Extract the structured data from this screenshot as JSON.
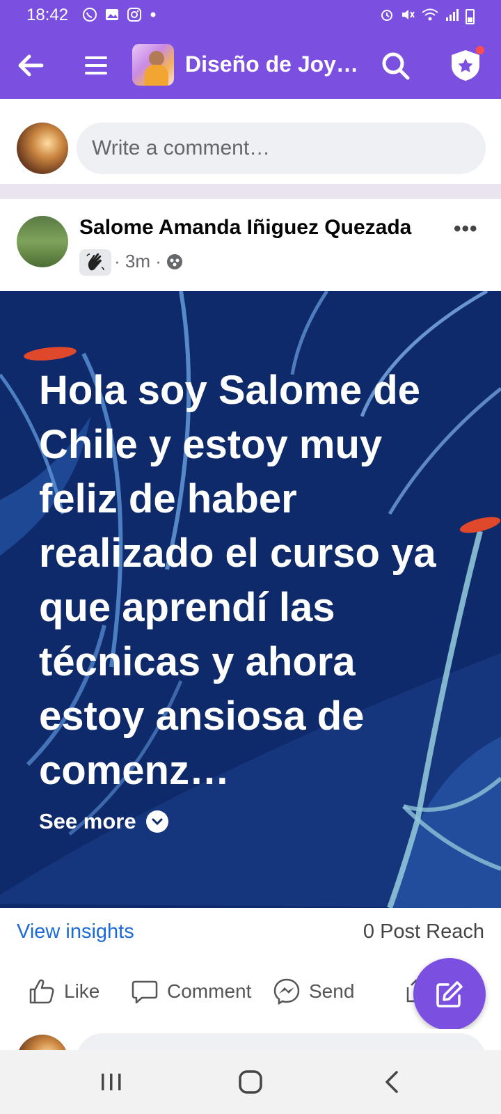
{
  "status_bar": {
    "time": "18:42",
    "left_icons": [
      "whatsapp-icon",
      "gallery-icon",
      "instagram-icon",
      "dot-icon"
    ],
    "right_icons": [
      "alarm-icon",
      "mute-icon",
      "wifi-icon",
      "signal-icon",
      "battery-icon"
    ]
  },
  "app_bar": {
    "title": "Diseño de Joy…",
    "accent_color": "#7b4fe0"
  },
  "composer": {
    "placeholder": "Write a comment…"
  },
  "post": {
    "author": "Salome Amanda Iñiguez Quezada",
    "badge_icon": "waving-hand-icon",
    "time": "· 3m ·",
    "privacy_icon": "group-privacy-icon",
    "text": "Hola soy Salome de Chile y estoy muy feliz de haber realizado el curso ya que aprendí las técnicas y ahora estoy ansiosa de comenz…",
    "see_more": "See more",
    "background_color": "#0e2a6a"
  },
  "insights": {
    "view_label": "View insights",
    "reach": "0 Post Reach"
  },
  "actions": {
    "like": "Like",
    "comment": "Comment",
    "send": "Send"
  },
  "nav_bar": {
    "icons": [
      "recent-apps-icon",
      "home-icon",
      "back-nav-icon"
    ]
  }
}
